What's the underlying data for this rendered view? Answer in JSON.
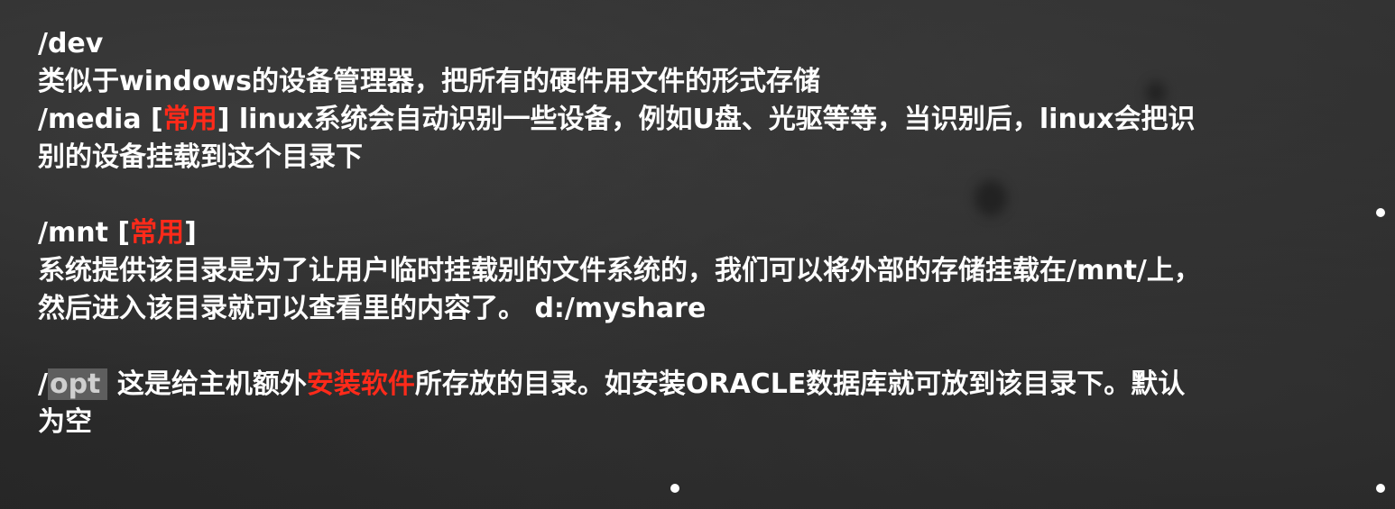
{
  "slide": {
    "dev_title": "/dev",
    "dev_desc": "类似于windows的设备管理器，把所有的硬件用文件的形式存储",
    "media_path": "/media [",
    "media_tag": "常用",
    "media_desc_1": "] linux系统会自动识别一些设备，例如U盘、光驱等等，当识别后，linux会把识",
    "media_desc_2": "别的设备挂载到这个目录下",
    "mnt_path": "/mnt [",
    "mnt_tag": "常用",
    "mnt_close": "]",
    "mnt_desc_1": "系统提供该目录是为了让用户临时挂载别的文件系统的，我们可以将外部的存储挂载在/mnt/上，",
    "mnt_desc_2": "然后进入该目录就可以查看里的内容了。 d:/myshare",
    "opt_slash": "/",
    "opt_word": "opt",
    "opt_desc_pre": " 这是给主机额外",
    "opt_highlight": "安装软件",
    "opt_desc_post": "所存放的目录。如安装ORACLE数据库就可放到该目录下。默认",
    "opt_desc_2": "为空"
  },
  "colors": {
    "background": "#2b2b2b",
    "text": "#ffffff",
    "highlight": "#ff2a1a",
    "opt_box": "#5e5e5e"
  }
}
